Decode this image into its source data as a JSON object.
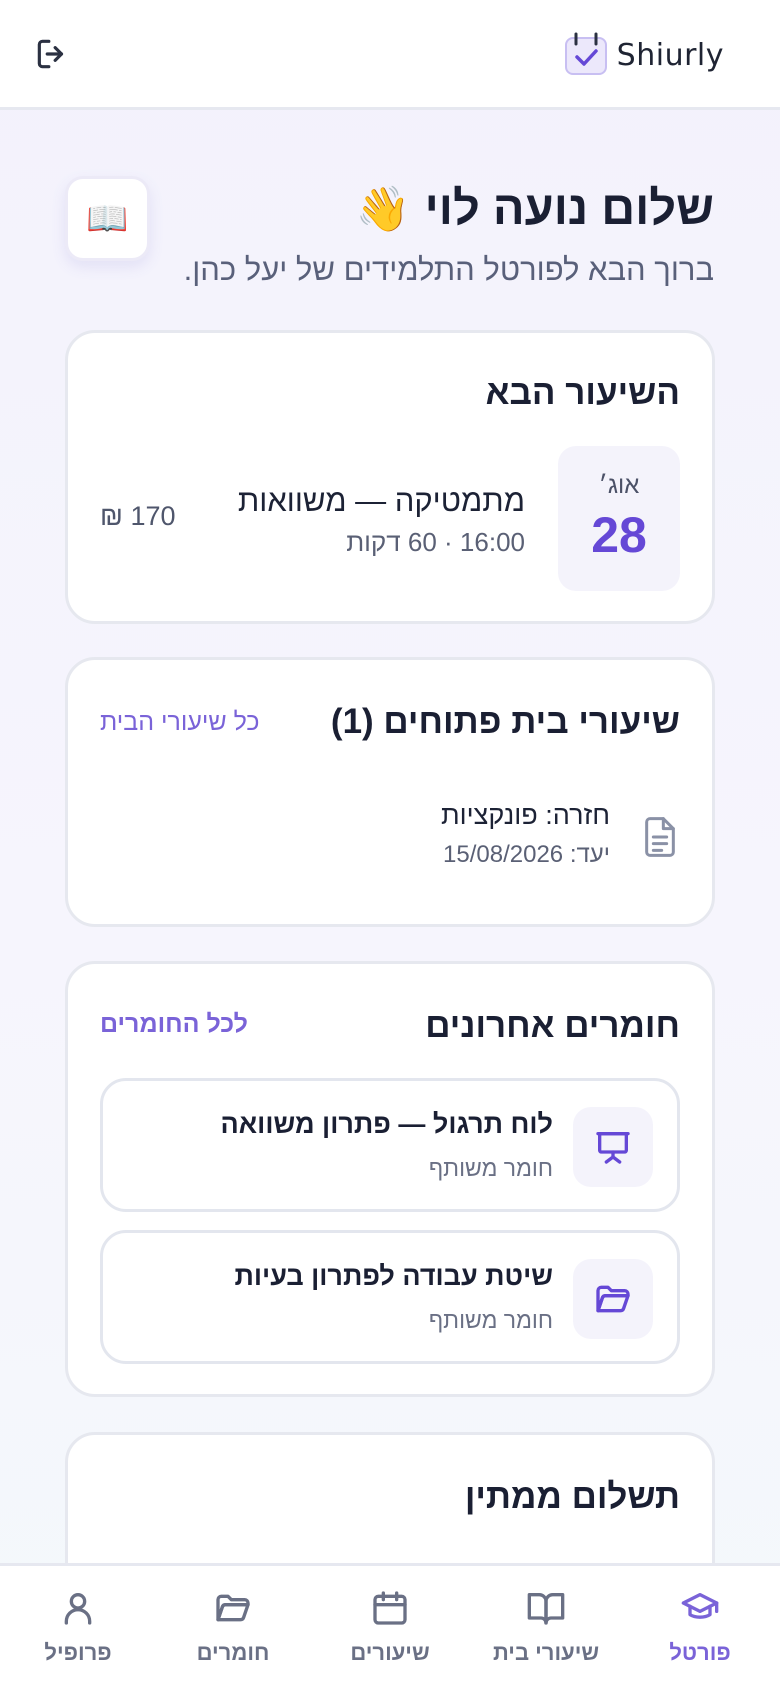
{
  "header": {
    "brand_name": "Shiurly",
    "logout_icon": "logout-icon",
    "logo_icon": "calendar-check-icon"
  },
  "greeting": {
    "title": "שלום נועה לוי",
    "wave": "👋",
    "subtitle": "ברוך הבא לפורטל התלמידים של יעל כהן.",
    "badge_icon": "📖"
  },
  "next_lesson": {
    "title": "השיעור הבא",
    "month": "אוג׳",
    "day": "28",
    "subject": "מתמטיקה — משוואות",
    "time": "16:00 · 60 דקות",
    "price": "170 ₪"
  },
  "homework": {
    "title": "שיעורי בית פתוחים (1)",
    "link": "כל שיעורי הבית",
    "items": [
      {
        "title": "חזרה: פונקציות",
        "due": "יעד: 15/08/2026",
        "icon": "document-icon"
      }
    ]
  },
  "materials": {
    "title": "חומרים אחרונים",
    "link": "לכל החומרים",
    "items": [
      {
        "title": "לוח תרגול — פתרון משוואה",
        "subtitle": "חומר משותף",
        "icon": "presentation-icon"
      },
      {
        "title": "שיטת עבודה לפתרון בעיות",
        "subtitle": "חומר משותף",
        "icon": "folder-icon"
      }
    ]
  },
  "payment": {
    "title": "תשלום ממתין"
  },
  "nav": {
    "items": [
      {
        "label": "פורטל",
        "icon": "graduation-cap-icon",
        "active": true
      },
      {
        "label": "שיעורי בית",
        "icon": "book-open-icon",
        "active": false
      },
      {
        "label": "שיעורים",
        "icon": "calendar-icon",
        "active": false
      },
      {
        "label": "חומרים",
        "icon": "folder-icon",
        "active": false
      },
      {
        "label": "פרופיל",
        "icon": "user-icon",
        "active": false
      }
    ]
  },
  "colors": {
    "accent": "#6548d6",
    "link": "#7a63d8",
    "text": "#1a1f33",
    "muted": "#5a6075",
    "card_border": "#e6e8ef"
  }
}
